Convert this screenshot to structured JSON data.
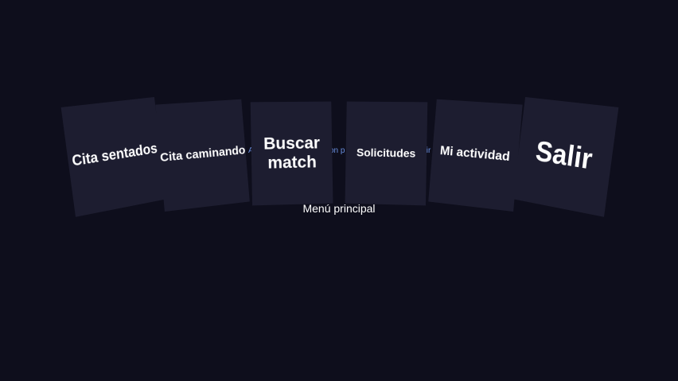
{
  "menu": {
    "caption": "Menú principal",
    "cards": [
      {
        "id": "cita-sentados",
        "label": "Cita sentados"
      },
      {
        "id": "cita-caminando",
        "label": "Cita caminando"
      },
      {
        "id": "buscar-match",
        "label": "Buscar match"
      },
      {
        "id": "solicitudes",
        "label": "Solicitudes"
      },
      {
        "id": "mi-actividad",
        "label": "Mi actividad"
      },
      {
        "id": "salir",
        "label": "Salir"
      }
    ],
    "peeks": {
      "left": "Ap",
      "middle": "on p",
      "right": "alir"
    }
  },
  "colors": {
    "background": "#0e0e1c",
    "card": "#1d1d30",
    "text": "#ffffff",
    "peek_text": "#6a8fe0"
  }
}
